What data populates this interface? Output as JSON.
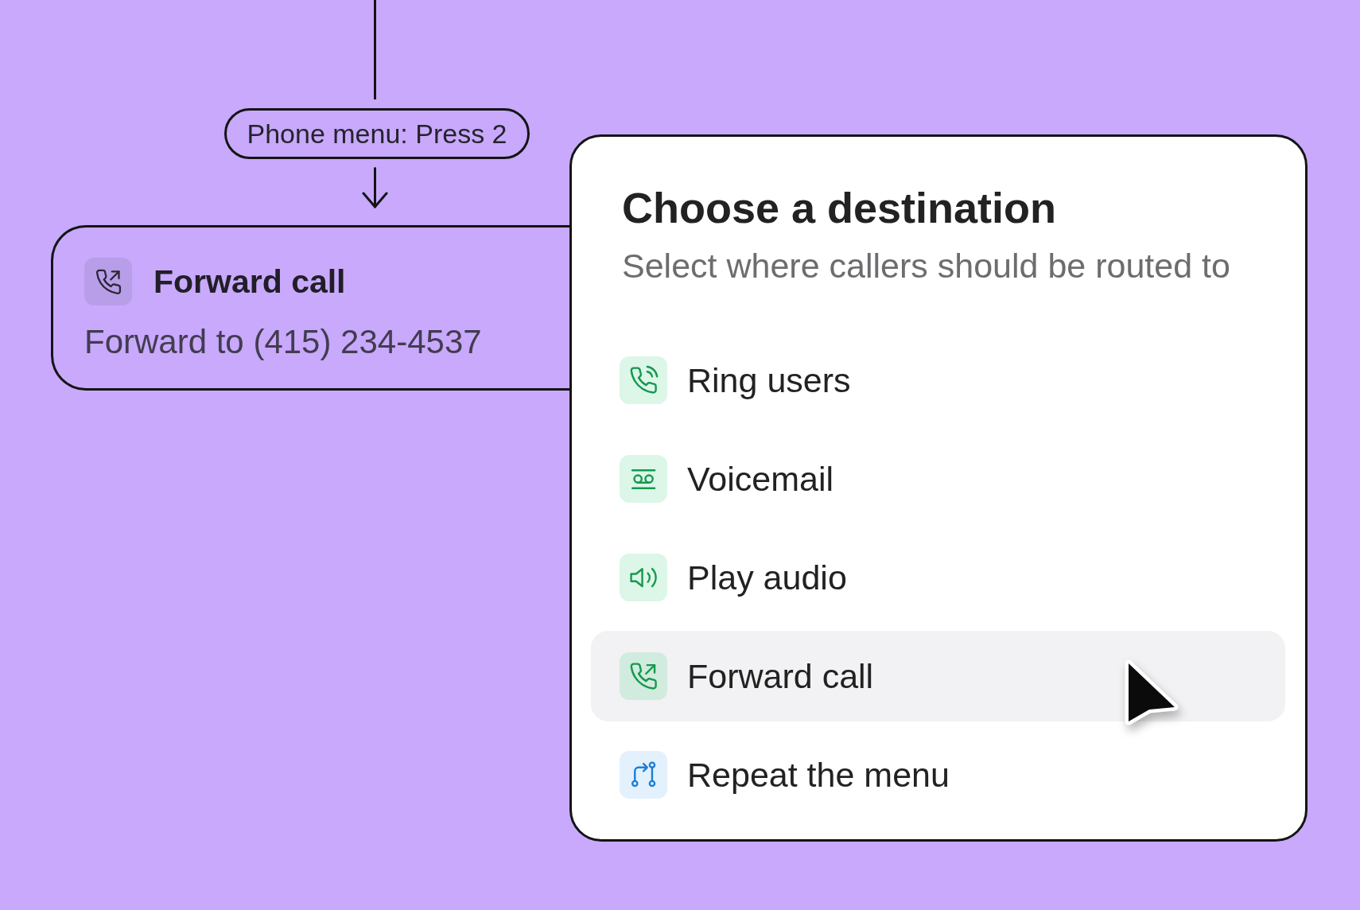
{
  "flow": {
    "branch_label": "Phone menu: Press 2",
    "node": {
      "title": "Forward call",
      "detail": "Forward to (415) 234-4537"
    }
  },
  "destination_menu": {
    "title": "Choose a destination",
    "subtitle": "Select where callers should be routed to",
    "options": [
      {
        "kind": "ring",
        "label": "Ring users",
        "highlighted": false
      },
      {
        "kind": "voicemail",
        "label": "Voicemail",
        "highlighted": false
      },
      {
        "kind": "audio",
        "label": "Play audio",
        "highlighted": false
      },
      {
        "kind": "forward",
        "label": "Forward call",
        "highlighted": true
      },
      {
        "kind": "repeat",
        "label": "Repeat the menu",
        "highlighted": false
      }
    ]
  }
}
